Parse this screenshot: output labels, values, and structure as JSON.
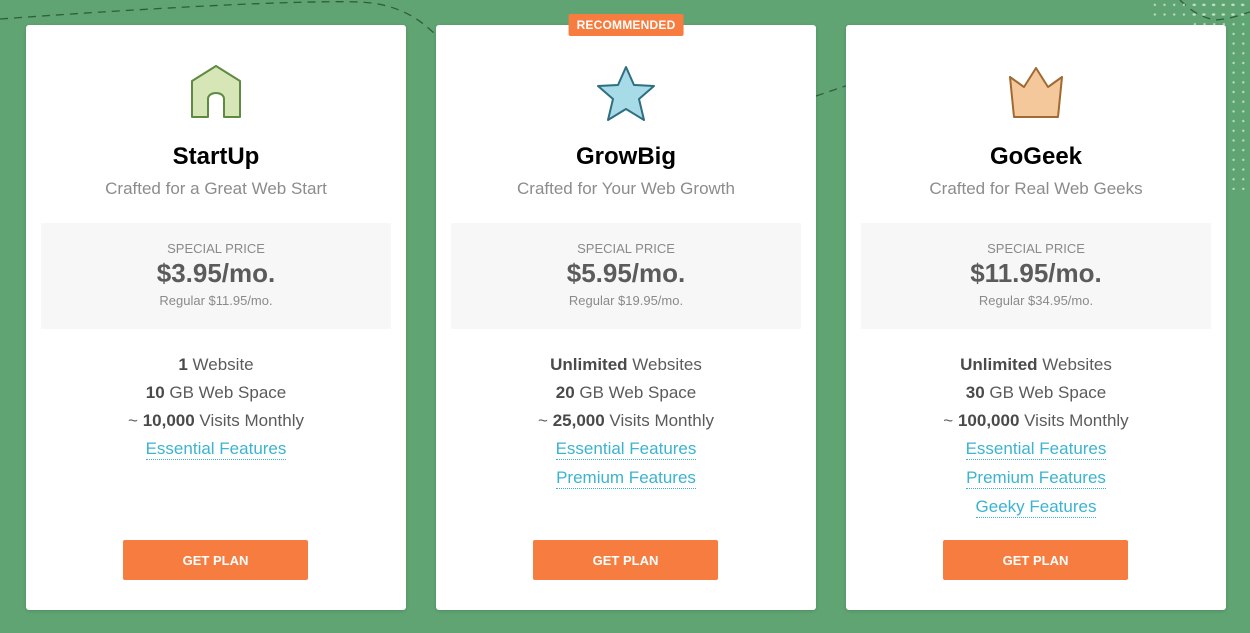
{
  "colors": {
    "background": "#5fa472",
    "accent": "#f77c3f",
    "link": "#3cb3cf"
  },
  "plans": [
    {
      "icon": "house-icon",
      "name": "StartUp",
      "tagline": "Crafted for a Great Web Start",
      "badge": null,
      "price_label": "SPECIAL PRICE",
      "price": "$3.95/mo.",
      "regular": "Regular $11.95/mo.",
      "features": [
        {
          "bold": "1",
          "text": " Website"
        },
        {
          "bold": "10",
          "text": " GB Web Space"
        },
        {
          "prefix": "~ ",
          "bold": "10,000",
          "text": " Visits Monthly"
        }
      ],
      "links": [
        "Essential Features"
      ],
      "button": "GET PLAN"
    },
    {
      "icon": "star-icon",
      "name": "GrowBig",
      "tagline": "Crafted for Your Web Growth",
      "badge": "RECOMMENDED",
      "price_label": "SPECIAL PRICE",
      "price": "$5.95/mo.",
      "regular": "Regular $19.95/mo.",
      "features": [
        {
          "bold": "Unlimited",
          "text": " Websites"
        },
        {
          "bold": "20",
          "text": " GB Web Space"
        },
        {
          "prefix": "~ ",
          "bold": "25,000",
          "text": " Visits Monthly"
        }
      ],
      "links": [
        "Essential Features",
        "Premium Features"
      ],
      "button": "GET PLAN"
    },
    {
      "icon": "crown-icon",
      "name": "GoGeek",
      "tagline": "Crafted for Real Web Geeks",
      "badge": null,
      "price_label": "SPECIAL PRICE",
      "price": "$11.95/mo.",
      "regular": "Regular $34.95/mo.",
      "features": [
        {
          "bold": "Unlimited",
          "text": " Websites"
        },
        {
          "bold": "30",
          "text": " GB Web Space"
        },
        {
          "prefix": "~ ",
          "bold": "100,000",
          "text": " Visits Monthly"
        }
      ],
      "links": [
        "Essential Features",
        "Premium Features",
        "Geeky Features"
      ],
      "button": "GET PLAN"
    }
  ]
}
